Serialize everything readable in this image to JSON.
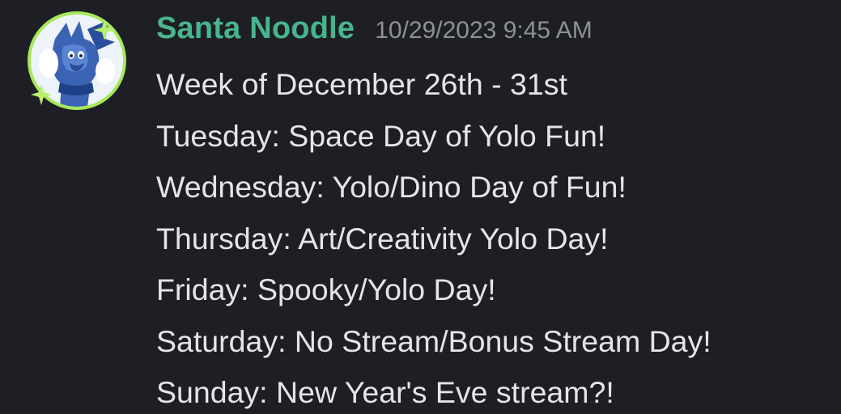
{
  "message": {
    "author": "Santa Noodle",
    "timestamp": "10/29/2023 9:45 AM",
    "lines": [
      "Week of December 26th - 31st",
      "Tuesday: Space Day of Yolo Fun!",
      "Wednesday: Yolo/Dino Day of Fun!",
      "Thursday: Art/Creativity Yolo Day!",
      "Friday: Spooky/Yolo Day!",
      "Saturday: No Stream/Bonus Stream Day!",
      "Sunday: New Year's Eve stream?!"
    ]
  },
  "colors": {
    "background": "#1e1f24",
    "username": "#48b48e",
    "timestamp": "#8d9097",
    "text": "#e3e5ea",
    "avatar_ring": "#a6e85a"
  },
  "icons": {
    "avatar": "blue-dragon-avatar",
    "decoration": "sparkle-icon"
  }
}
